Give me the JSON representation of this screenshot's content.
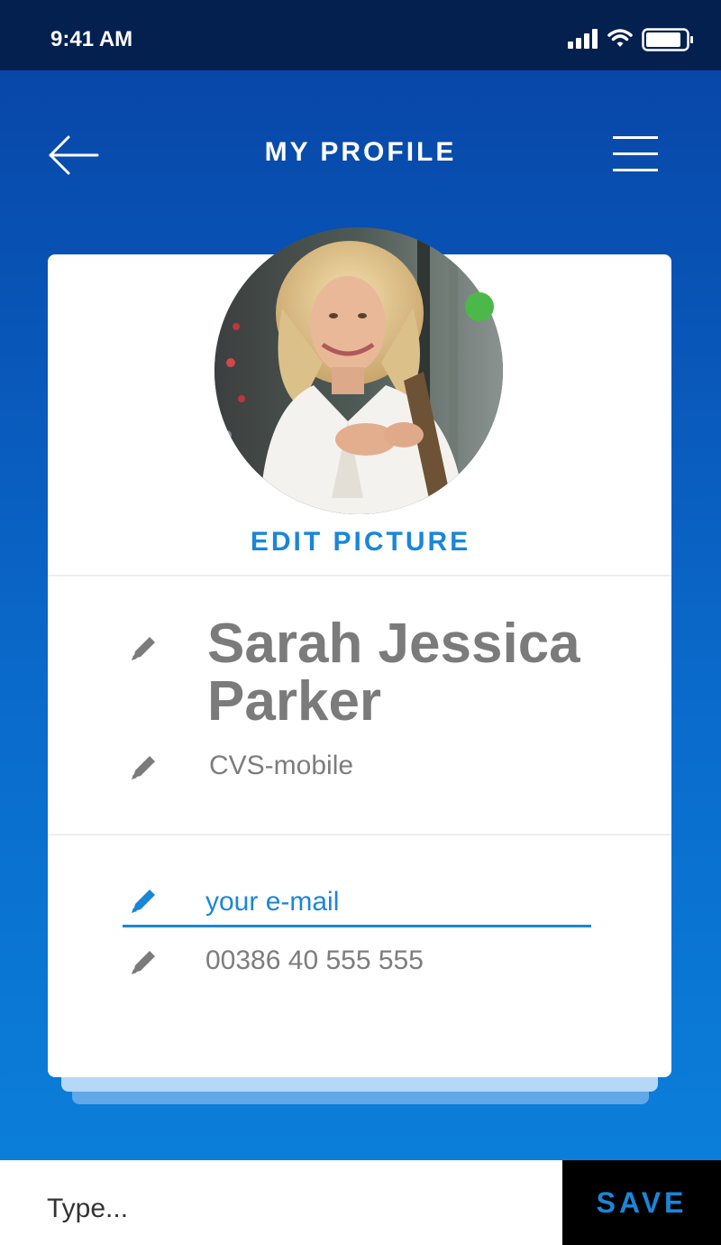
{
  "status_bar": {
    "time": "9:41 AM"
  },
  "header": {
    "title": "MY PROFILE"
  },
  "profile": {
    "edit_picture_label": "EDIT PICTURE",
    "name": "Sarah Jessica Parker",
    "company": "CVS-mobile",
    "email_placeholder": "your e-mail",
    "phone": "00386 40 555 555",
    "online": true
  },
  "composer": {
    "placeholder": "Type...",
    "save_label": "SAVE"
  },
  "colors": {
    "accent": "#1a86d8",
    "status_bar": "#03204f",
    "online": "#4cb84a"
  }
}
